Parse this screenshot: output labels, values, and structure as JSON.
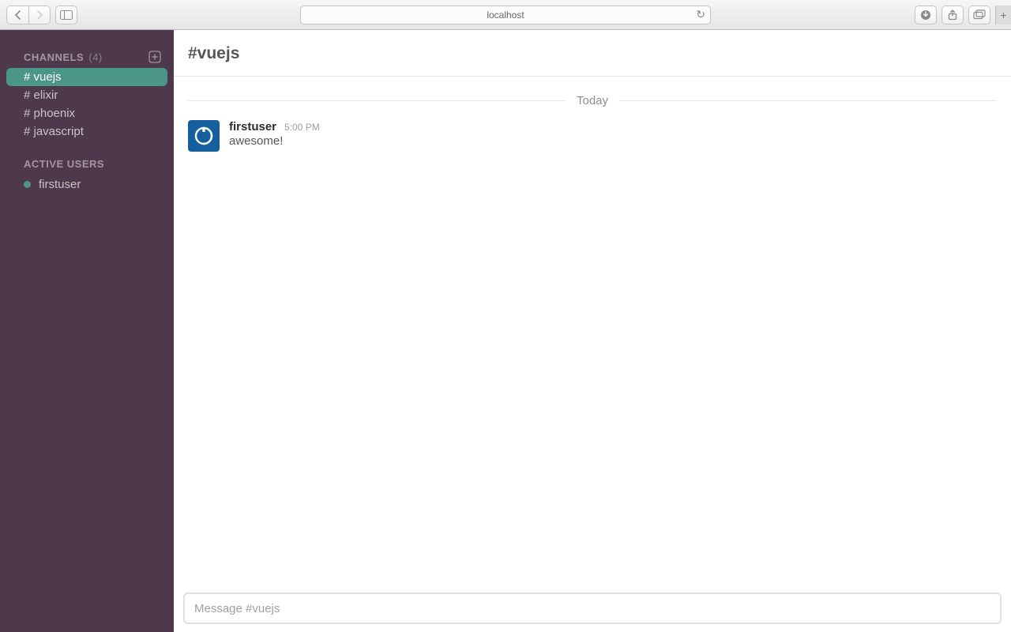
{
  "browser": {
    "address": "localhost"
  },
  "sidebar": {
    "channels_title": "CHANNELS",
    "channels_count": "(4)",
    "channels": [
      {
        "label": "# vuejs",
        "active": true
      },
      {
        "label": "# elixir",
        "active": false
      },
      {
        "label": "# phoenix",
        "active": false
      },
      {
        "label": "# javascript",
        "active": false
      }
    ],
    "users_title": "ACTIVE USERS",
    "users": [
      {
        "name": "firstuser",
        "online": true
      }
    ]
  },
  "header": {
    "channel_name": "#vuejs"
  },
  "messages": {
    "date_label": "Today",
    "items": [
      {
        "user": "firstuser",
        "time": "5:00 PM",
        "text": "awesome!"
      }
    ]
  },
  "composer": {
    "placeholder": "Message #vuejs"
  }
}
